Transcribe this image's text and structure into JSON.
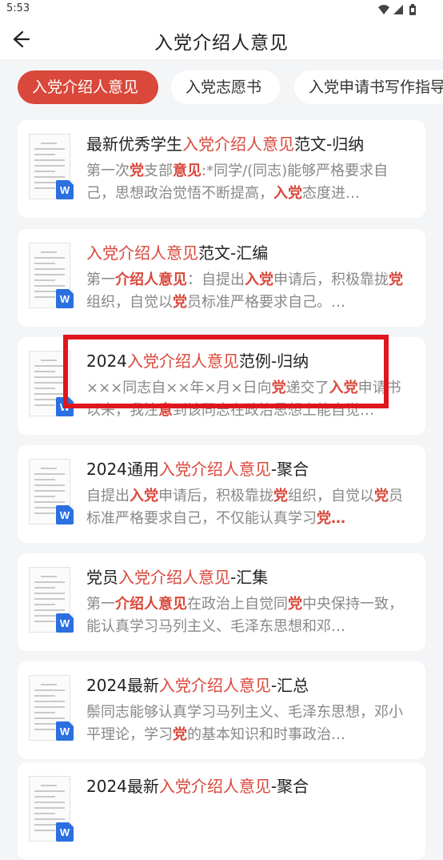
{
  "status_bar": {
    "time": "5:53",
    "icons": [
      "wifi-icon",
      "signal-icon",
      "battery-icon"
    ]
  },
  "header": {
    "title": "入党介绍人意见",
    "back_icon": "arrow-left-icon"
  },
  "tabs": [
    {
      "label": "入党介绍人意见",
      "active": true
    },
    {
      "label": "入党志愿书",
      "active": false
    },
    {
      "label": "入党申请书写作指导",
      "active": false
    }
  ],
  "colors": {
    "accent": "#d9483b",
    "highlight_box": "#e0161e",
    "word_icon": "#2b6fe0"
  },
  "cards": [
    {
      "title": {
        "pre": "最新优秀学生",
        "hl": "入党介绍人意见",
        "post": "范文-归纳"
      },
      "desc": [
        {
          "t": "第一次",
          "k": false
        },
        {
          "t": "党",
          "k": true
        },
        {
          "t": "支部",
          "k": false
        },
        {
          "t": "意见",
          "k": true
        },
        {
          "t": ":*同学/(同志)能够严格要求自己，思想政治觉悟不断提高，",
          "k": false
        },
        {
          "t": "入党",
          "k": true
        },
        {
          "t": "态度进…",
          "k": false
        }
      ]
    },
    {
      "title": {
        "pre": "",
        "hl": "入党介绍人意见",
        "post": "范文-汇编"
      },
      "desc": [
        {
          "t": "第一",
          "k": false
        },
        {
          "t": "介绍人意见",
          "k": true
        },
        {
          "t": "：自提出",
          "k": false
        },
        {
          "t": "入党",
          "k": true
        },
        {
          "t": "申请后，积极靠拢",
          "k": false
        },
        {
          "t": "党",
          "k": true
        },
        {
          "t": "组织，自觉以",
          "k": false
        },
        {
          "t": "党",
          "k": true
        },
        {
          "t": "员标准严格要求自己。…",
          "k": false
        }
      ]
    },
    {
      "title": {
        "pre": "2024",
        "hl": "入党介绍人意见",
        "post": "范例-归纳"
      },
      "desc": [
        {
          "t": "×××同志自××年×月×日向",
          "k": false
        },
        {
          "t": "党",
          "k": true
        },
        {
          "t": "递交了",
          "k": false
        },
        {
          "t": "入党",
          "k": true
        },
        {
          "t": "申请书以来，我注",
          "k": false
        },
        {
          "t": "意",
          "k": true
        },
        {
          "t": "到该同志在政治思想上能自觉…",
          "k": false
        }
      ]
    },
    {
      "title": {
        "pre": "2024通用",
        "hl": "入党介绍人意见",
        "post": "-聚合"
      },
      "desc": [
        {
          "t": "自提出",
          "k": false
        },
        {
          "t": "入党",
          "k": true
        },
        {
          "t": "申请后，积极靠拢",
          "k": false
        },
        {
          "t": "党",
          "k": true
        },
        {
          "t": "组织，自觉以",
          "k": false
        },
        {
          "t": "党",
          "k": true
        },
        {
          "t": "员标准严格要求自己，不仅能认真学习",
          "k": false
        },
        {
          "t": "党…",
          "k": true
        }
      ]
    },
    {
      "title": {
        "pre": "党员",
        "hl": "入党介绍人意见",
        "post": "-汇集"
      },
      "desc": [
        {
          "t": "第一",
          "k": false
        },
        {
          "t": "介绍人意见",
          "k": true
        },
        {
          "t": "在政治上自觉同",
          "k": false
        },
        {
          "t": "党",
          "k": true
        },
        {
          "t": "中央保持一致，能认真学习马列主义、毛泽东思想和邓…",
          "k": false
        }
      ]
    },
    {
      "title": {
        "pre": "2024最新",
        "hl": "入党介绍人意见",
        "post": "-汇总"
      },
      "desc": [
        {
          "t": "鬃同志能够认真学习马列主义、毛泽东思想，邓小平理论，学习",
          "k": false
        },
        {
          "t": "党",
          "k": true
        },
        {
          "t": "的基本知识和时事政治…",
          "k": false
        }
      ]
    },
    {
      "title": {
        "pre": "2024最新",
        "hl": "入党介绍人意见",
        "post": "-聚合"
      },
      "desc": []
    }
  ]
}
